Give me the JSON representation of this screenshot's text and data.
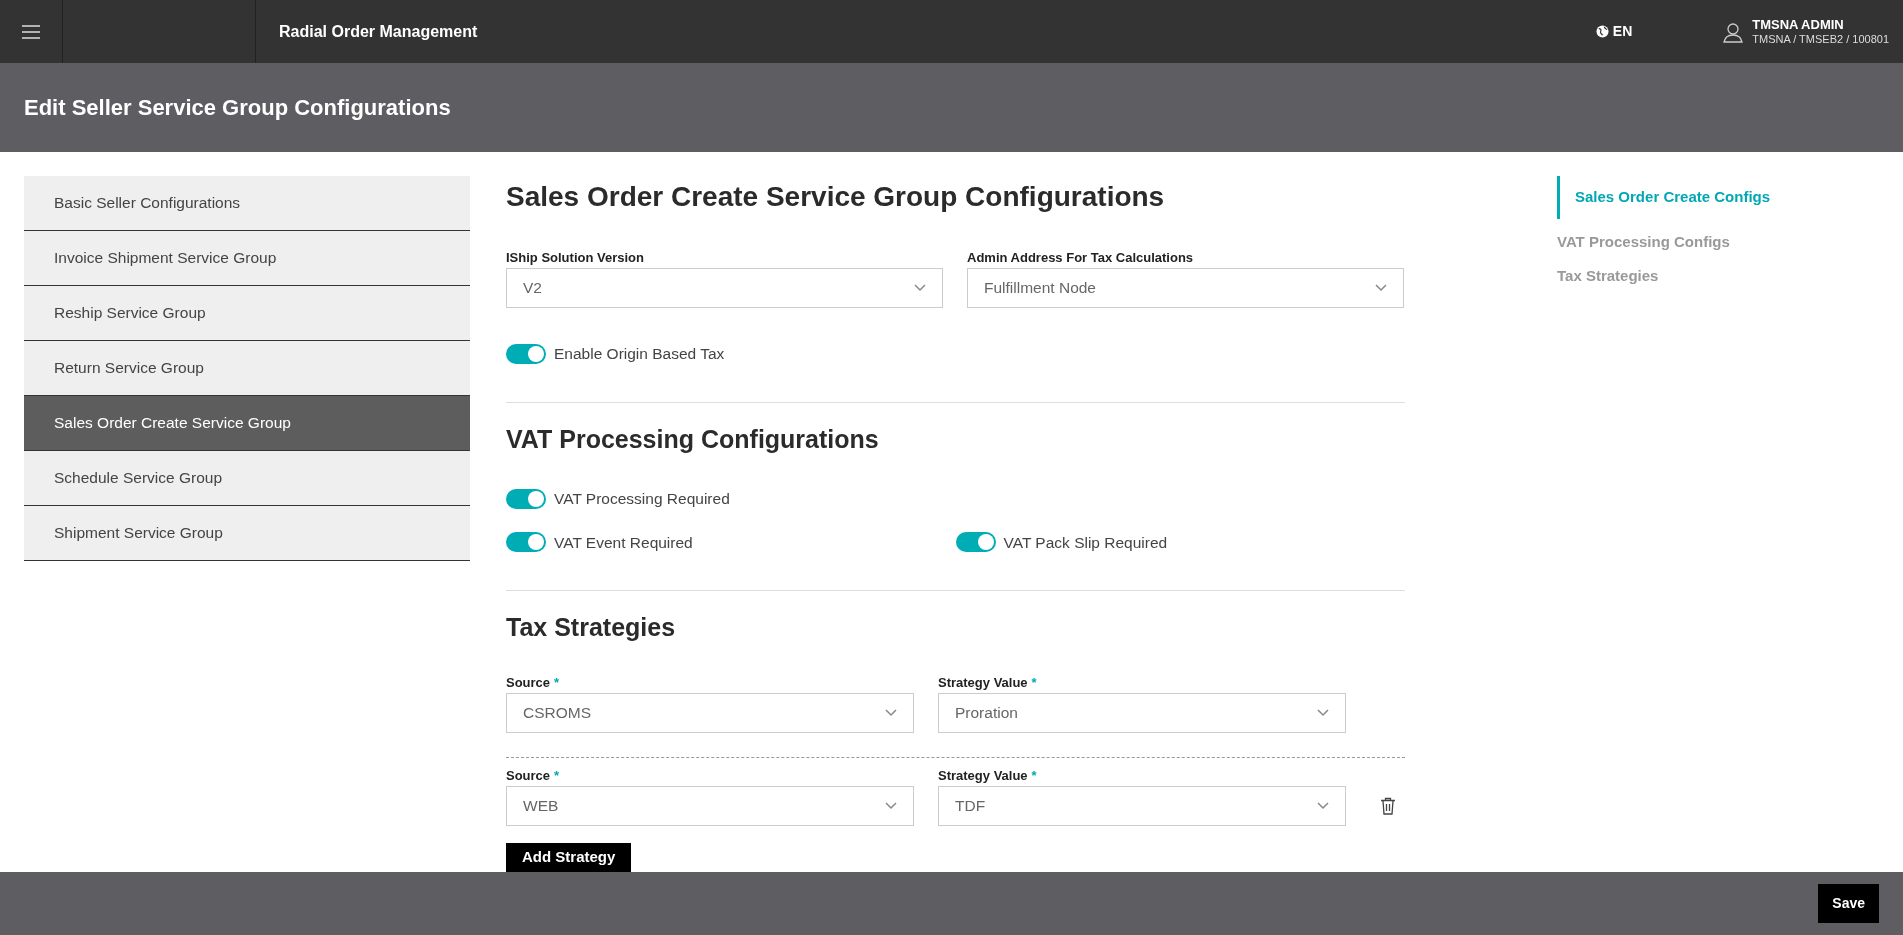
{
  "top_bar": {
    "app_title": "Radial Order Management",
    "language": "EN",
    "user_name": "TMSNA ADMIN",
    "user_context": "TMSNA / TMSEB2 / 100801"
  },
  "page_title": "Edit Seller Service Group Configurations",
  "sidebar": {
    "items": [
      {
        "label": "Basic Seller Configurations",
        "selected": false
      },
      {
        "label": "Invoice Shipment Service Group",
        "selected": false
      },
      {
        "label": "Reship Service Group",
        "selected": false
      },
      {
        "label": "Return Service Group",
        "selected": false
      },
      {
        "label": "Sales Order Create Service Group",
        "selected": true
      },
      {
        "label": "Schedule Service Group",
        "selected": false
      },
      {
        "label": "Shipment Service Group",
        "selected": false
      }
    ]
  },
  "sales_order_section": {
    "heading": "Sales Order Create Service Group Configurations",
    "selects": [
      {
        "label": "IShip Solution Version",
        "value": "V2"
      },
      {
        "label": "Admin Address For Tax Calculations",
        "value": "Fulfillment Node"
      }
    ],
    "toggles": [
      {
        "label": "Enable Origin Based Tax",
        "on": true
      }
    ]
  },
  "vat_section": {
    "heading": "VAT Processing Configurations",
    "toggle_rows": [
      [
        {
          "label": "VAT Processing Required",
          "on": true
        }
      ],
      [
        {
          "label": "VAT Event Required",
          "on": true
        },
        {
          "label": "VAT Pack Slip Required",
          "on": true
        }
      ]
    ]
  },
  "tax_section": {
    "heading": "Tax Strategies",
    "strategies": [
      {
        "source_label": "Source",
        "source_required_mark": "*",
        "source": "CSROMS",
        "value_label": "Strategy Value",
        "value_required_mark": "*",
        "value": "Proration",
        "deletable": false
      },
      {
        "source_label": "Source",
        "source_required_mark": "*",
        "source": "WEB",
        "value_label": "Strategy Value",
        "value_required_mark": "*",
        "value": "TDF",
        "deletable": true
      }
    ],
    "add_button": "Add Strategy"
  },
  "right_nav": {
    "items": [
      {
        "label": "Sales Order Create Configs",
        "selected": true
      },
      {
        "label": "VAT Processing Configs",
        "selected": false
      },
      {
        "label": "Tax Strategies",
        "selected": false
      }
    ]
  },
  "footer": {
    "save_button": "Save"
  }
}
